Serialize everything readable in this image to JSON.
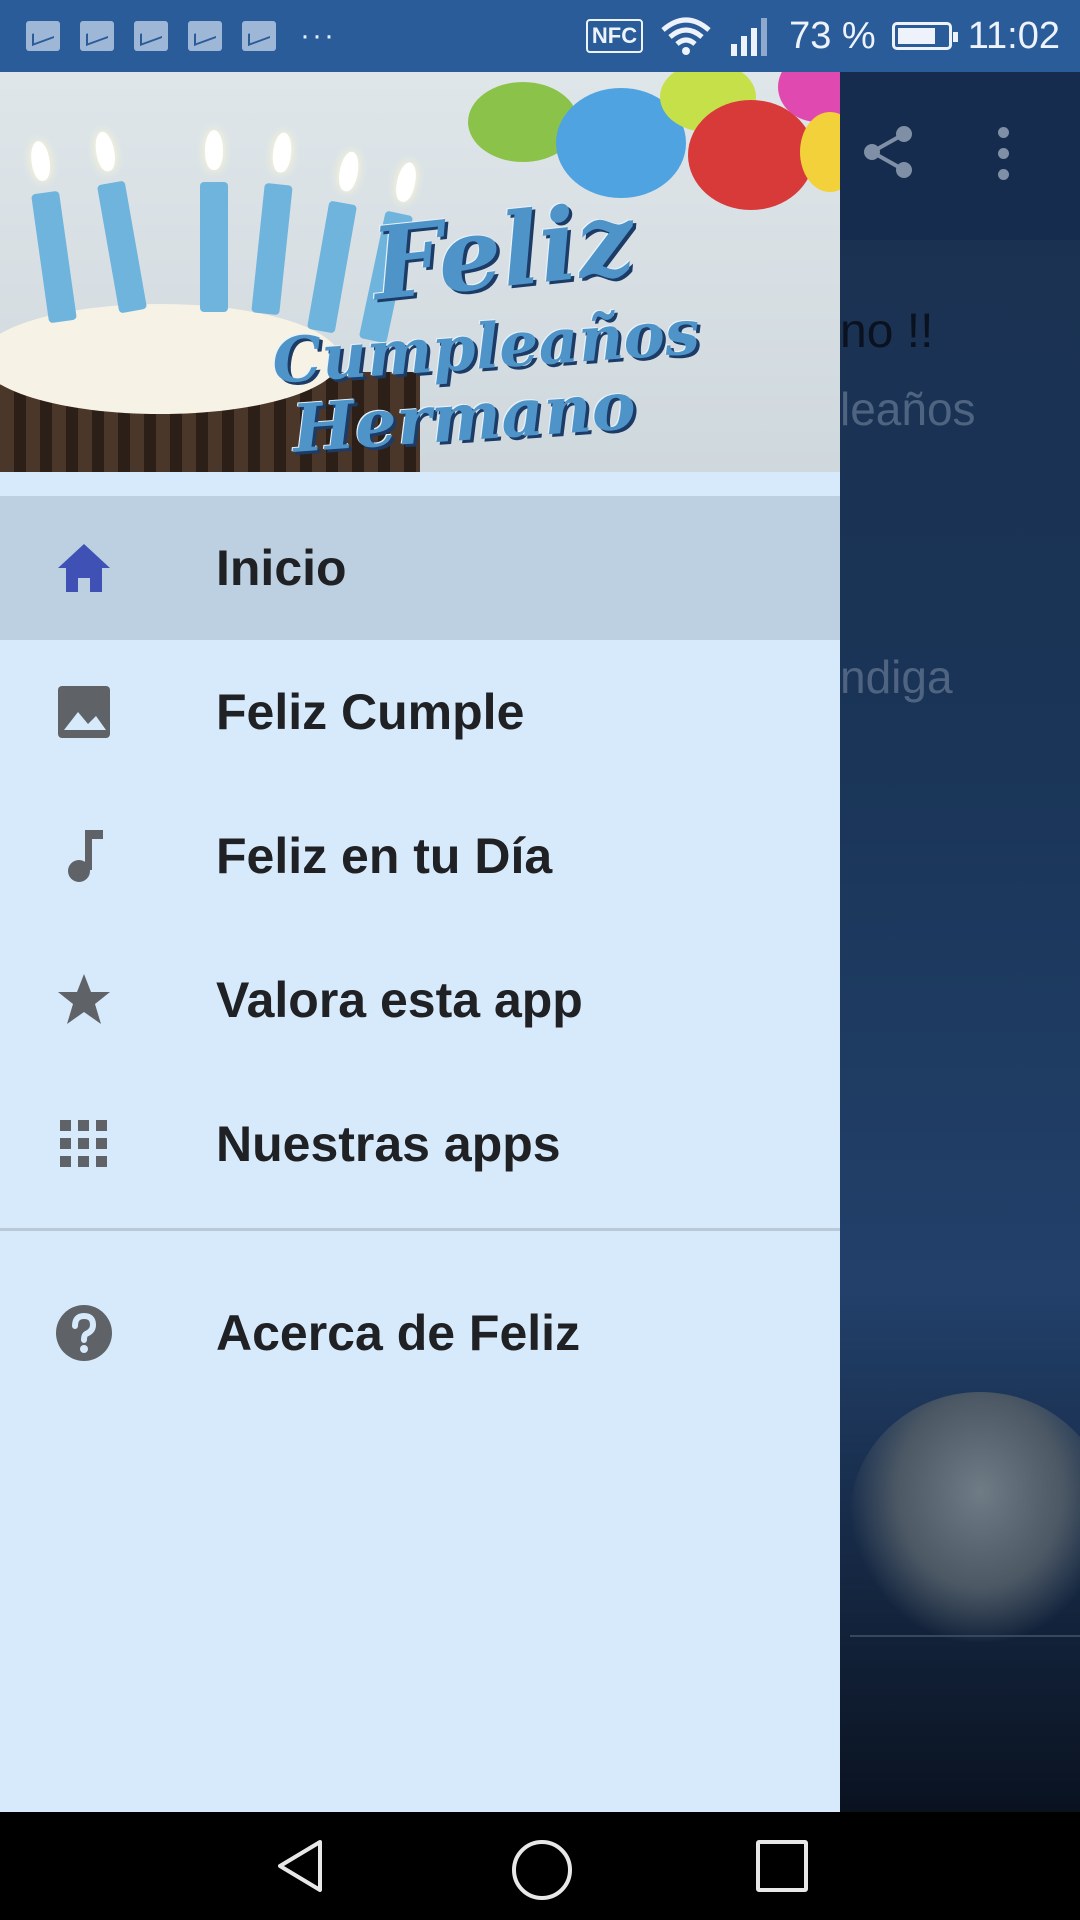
{
  "status_bar": {
    "notification_icons": [
      "notification-icon",
      "notification-icon",
      "notification-icon",
      "notification-icon",
      "notification-icon"
    ],
    "more_notifications": "···",
    "nfc": "NFC",
    "battery_percent": "73 %",
    "battery_level": 0.73,
    "time": "11:02"
  },
  "background_app": {
    "text_line1": "no !!",
    "text_line2": "leaños",
    "text_line3": "ndiga"
  },
  "drawer": {
    "header": {
      "title_line1": "Feliz",
      "title_line2": "Cumpleaños",
      "title_line3": "Hermano"
    },
    "items": [
      {
        "label": "Inicio",
        "icon": "home-icon",
        "active": true
      },
      {
        "label": "Feliz Cumple",
        "icon": "image-icon",
        "active": false
      },
      {
        "label": "Feliz en tu Día",
        "icon": "music-note-icon",
        "active": false
      },
      {
        "label": "Valora esta app",
        "icon": "star-icon",
        "active": false
      },
      {
        "label": "Nuestras apps",
        "icon": "apps-grid-icon",
        "active": false
      }
    ],
    "footer_items": [
      {
        "label": "Acerca de Feliz",
        "icon": "help-icon"
      }
    ]
  },
  "colors": {
    "status_bar": "#2a5c9a",
    "drawer_bg": "#d7eafb",
    "active_item": "#bcd0e2",
    "home_icon": "#3f51b5",
    "icon_gray": "#5f6368"
  }
}
